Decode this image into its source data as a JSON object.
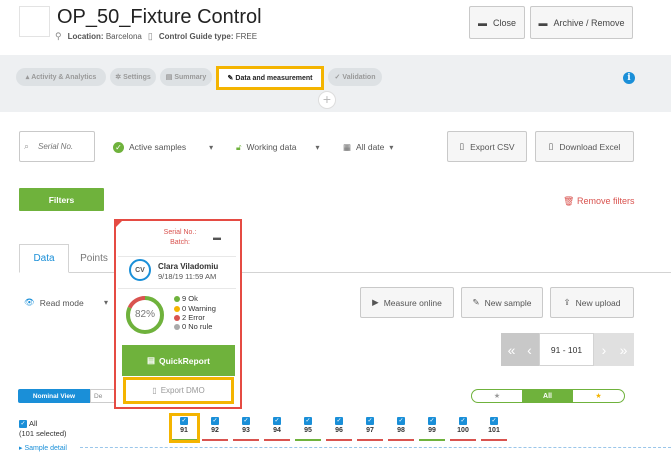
{
  "header": {
    "title": "OP_50_Fixture Control",
    "location_label": "Location:",
    "location_value": "Barcelona",
    "guide_label": "Control Guide type:",
    "guide_value": "FREE",
    "close_label": "Close",
    "archive_label": "Archive / Remove"
  },
  "tabs": [
    {
      "label": "Activity & Analytics",
      "icon": "chart-icon"
    },
    {
      "label": "Settings",
      "icon": "gear-icon"
    },
    {
      "label": "Summary",
      "icon": "doc-icon"
    },
    {
      "label": "Data and measurement",
      "icon": "pencil-icon",
      "active": true
    },
    {
      "label": "Validation",
      "icon": "check-icon"
    }
  ],
  "toolbar": {
    "serial_placeholder": "Serial No.",
    "active_samples": "Active samples",
    "working_data": "Working data",
    "date": "All date",
    "export_csv": "Export CSV",
    "download_excel": "Download Excel",
    "filters": "Filters",
    "remove_filters": "Remove filters"
  },
  "subtabs": {
    "data": "Data",
    "points": "Points"
  },
  "actions": {
    "read_mode": "Read mode",
    "measure_online": "Measure online",
    "new_sample": "New sample",
    "new_upload": "New upload"
  },
  "pager": {
    "range": "91 - 101",
    "first": "«",
    "prev": "‹",
    "next": "›",
    "last": "»"
  },
  "view": {
    "nominal": "Nominal View",
    "other": "De"
  },
  "star_filter": {
    "all": "All",
    "left": "★",
    "right": "★"
  },
  "selection": {
    "all_label": "All",
    "count_label": "(101 selected)",
    "sample_detail": "Sample detail"
  },
  "samples": [
    {
      "num": "91",
      "status": "ok"
    },
    {
      "num": "92",
      "status": "error"
    },
    {
      "num": "93",
      "status": "error"
    },
    {
      "num": "94",
      "status": "error"
    },
    {
      "num": "95",
      "status": "ok"
    },
    {
      "num": "96",
      "status": "error"
    },
    {
      "num": "97",
      "status": "error"
    },
    {
      "num": "98",
      "status": "error"
    },
    {
      "num": "99",
      "status": "ok"
    },
    {
      "num": "100",
      "status": "error"
    },
    {
      "num": "101",
      "status": "error"
    }
  ],
  "popup": {
    "serial_label": "Serial No.:",
    "batch_label": "Batch:",
    "avatar": "CV",
    "user": "Clara Viladomiu",
    "date": "9/18/19 11:59 AM",
    "percent": "82%",
    "percent_value": 82,
    "legend": {
      "ok": "9 Ok",
      "warning": "0 Warning",
      "error": "2 Error",
      "norule": "0 No rule"
    },
    "quick_report": "QuickReport",
    "export_dmo": "Export DMO"
  },
  "colors": {
    "accent_blue": "#1a8fd8",
    "ok_green": "#6fb23c",
    "error_red": "#d9534f",
    "warning_yellow": "#f4b400",
    "highlight": "#f4b400"
  }
}
